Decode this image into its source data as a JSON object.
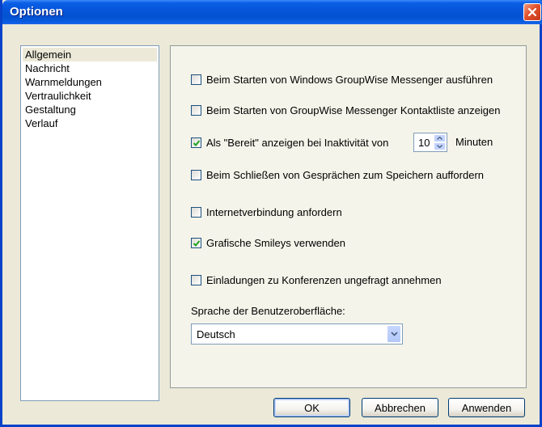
{
  "window": {
    "title": "Optionen"
  },
  "nav": {
    "items": [
      {
        "label": "Allgemein",
        "selected": true
      },
      {
        "label": "Nachricht",
        "selected": false
      },
      {
        "label": "Warnmeldungen",
        "selected": false
      },
      {
        "label": "Vertraulichkeit",
        "selected": false
      },
      {
        "label": "Gestaltung",
        "selected": false
      },
      {
        "label": "Verlauf",
        "selected": false
      }
    ]
  },
  "options": {
    "start_messenger": {
      "label": "Beim Starten von Windows GroupWise Messenger ausführen",
      "checked": false
    },
    "show_contacts": {
      "label": "Beim Starten von GroupWise Messenger Kontaktliste anzeigen",
      "checked": false
    },
    "show_ready": {
      "label": "Als \"Bereit\" anzeigen bei Inaktivität von",
      "checked": true,
      "minutes": "10",
      "unit": "Minuten"
    },
    "prompt_save": {
      "label": "Beim Schließen von Gesprächen zum Speichern auffordern",
      "checked": false
    },
    "internet": {
      "label": "Internetverbindung anfordern",
      "checked": false
    },
    "smileys": {
      "label": "Grafische Smileys verwenden",
      "checked": true
    },
    "conferences": {
      "label": "Einladungen zu Konferenzen ungefragt annehmen",
      "checked": false
    }
  },
  "language": {
    "label": "Sprache der Benutzeroberfläche:",
    "value": "Deutsch"
  },
  "buttons": {
    "ok": "OK",
    "cancel": "Abbrechen",
    "apply": "Anwenden"
  },
  "colors": {
    "titlebar": "#0654d8",
    "close": "#e0512c",
    "check": "#21a121"
  }
}
